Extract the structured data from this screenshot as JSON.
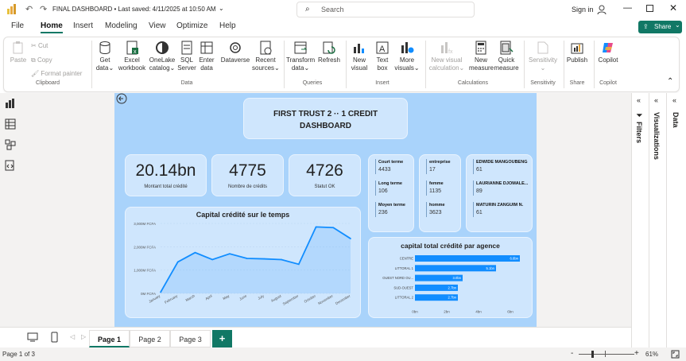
{
  "titlebar": {
    "title": "FINAL DASHBOARD",
    "saved": "Last saved: 4/11/2025 at 10:50 AM",
    "search_placeholder": "Search",
    "signin": "Sign in"
  },
  "menu": {
    "tabs": [
      "File",
      "Home",
      "Insert",
      "Modeling",
      "View",
      "Optimize",
      "Help"
    ],
    "share": "Share"
  },
  "ribbon": {
    "paste": "Paste",
    "cut": "Cut",
    "copy": "Copy",
    "format_painter": "Format painter",
    "clipboard": "Clipboard",
    "get_data": [
      "Get",
      "data"
    ],
    "excel": [
      "Excel",
      "workbook"
    ],
    "onelake": [
      "OneLake",
      "catalog"
    ],
    "sql": [
      "SQL",
      "Server"
    ],
    "enter": [
      "Enter",
      "data"
    ],
    "dataverse": "Dataverse",
    "recent": [
      "Recent",
      "sources"
    ],
    "data_group": "Data",
    "transform": [
      "Transform",
      "data"
    ],
    "refresh": "Refresh",
    "queries": "Queries",
    "new_visual": [
      "New",
      "visual"
    ],
    "text_box": [
      "Text",
      "box"
    ],
    "more_visuals": [
      "More",
      "visuals"
    ],
    "insert": "Insert",
    "new_visual_calc": [
      "New visual",
      "calculation"
    ],
    "new_measure": [
      "New",
      "measure"
    ],
    "quick_measure": [
      "Quick",
      "measure"
    ],
    "calculations": "Calculations",
    "sensitivity": "Sensitivity",
    "publish": "Publish",
    "share_group": "Share",
    "copilot": "Copilot"
  },
  "panes": {
    "filters": "Filters",
    "visualizations": "Visualizations",
    "data": "Data"
  },
  "report": {
    "title_line1": "FIRST TRUST 2 ·· 1 CREDIT",
    "title_line2": "DASHBOARD",
    "kpis": [
      {
        "value": "20.14bn",
        "label": "Montant total crédité"
      },
      {
        "value": "4775",
        "label": "Nombre de crédits"
      },
      {
        "value": "4726",
        "label": "Statut OK"
      }
    ],
    "terms": [
      {
        "label": "Court terme",
        "value": "4433"
      },
      {
        "label": "Long terme",
        "value": "106"
      },
      {
        "label": "Moyen terme",
        "value": "236"
      }
    ],
    "types": [
      {
        "label": "entreprise",
        "value": "17"
      },
      {
        "label": "femme",
        "value": "1135"
      },
      {
        "label": "homme",
        "value": "3623"
      }
    ],
    "clients": [
      {
        "label": "EDWIDE MANGOUBENG",
        "value": "61"
      },
      {
        "label": "LAURIANNE DJOMALE...",
        "value": "89"
      },
      {
        "label": "MATURIN ZANGUIM N.",
        "value": "61"
      }
    ]
  },
  "chart_data": [
    {
      "type": "area",
      "title": "Capital crédité sur le temps",
      "categories": [
        "January",
        "February",
        "March",
        "April",
        "May",
        "June",
        "July",
        "August",
        "September",
        "October",
        "November",
        "December"
      ],
      "values": [
        0.05,
        1.35,
        1.75,
        1.45,
        1.7,
        1.5,
        1.48,
        1.45,
        1.25,
        2.85,
        2.82,
        2.35
      ],
      "yticks": [
        "0M FCFA",
        "1,000M FCFA",
        "2,000M FCFA",
        "3,000M FCFA"
      ],
      "ylim": [
        0,
        3
      ],
      "color": "#118dff"
    },
    {
      "type": "bar",
      "orientation": "horizontal",
      "title": "capital total crédité par agence",
      "categories": [
        "CENTRE",
        "LITTORAL 1",
        "OUEST NORD OU...",
        "SUD-OUEST",
        "LITTORAL 2"
      ],
      "values": [
        6.6,
        5.1,
        3.0,
        2.7,
        2.7
      ],
      "labels": [
        "6.6bn",
        "5.1bn",
        "3.0bn",
        "2.7bn",
        "2.7bn"
      ],
      "xticks": [
        "0bn",
        "2bn",
        "4bn",
        "6bn"
      ],
      "xlim": [
        0,
        6
      ],
      "color": "#118dff"
    }
  ],
  "pages": {
    "tabs": [
      "Page 1",
      "Page 2",
      "Page 3"
    ],
    "add": "+"
  },
  "status": {
    "page": "Page 1 of 3",
    "zoom": "61%",
    "minus": "-",
    "plus": "+"
  }
}
